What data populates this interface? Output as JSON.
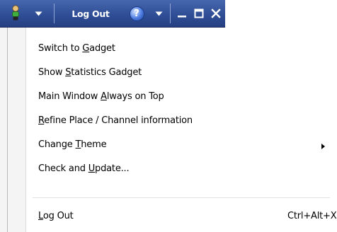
{
  "toolbar": {
    "logout_label": "Log Out",
    "help_glyph": "?",
    "icons": {
      "user": "person-status-icon",
      "menu_dropdown": "chevron-down-icon",
      "help": "help-icon",
      "help_dropdown": "chevron-down-icon",
      "minimize": "minimize-icon",
      "maximize": "maximize-icon",
      "close": "close-icon"
    },
    "colors": {
      "bar": "#2f4e96",
      "text": "#ffffff"
    }
  },
  "menu": {
    "items": [
      {
        "pre": "Switch to ",
        "key": "G",
        "post": "adget",
        "shortcut": "",
        "submenu": false
      },
      {
        "pre": "Show ",
        "key": "S",
        "post": "tatistics Gadget",
        "shortcut": "",
        "submenu": false
      },
      {
        "pre": "Main Window ",
        "key": "A",
        "post": "lways on Top",
        "shortcut": "",
        "submenu": false
      },
      {
        "pre": "",
        "key": "R",
        "post": "efine Place / Channel information",
        "shortcut": "",
        "submenu": false
      },
      {
        "pre": "Change ",
        "key": "T",
        "post": "heme",
        "shortcut": "",
        "submenu": true
      },
      {
        "pre": "Check and ",
        "key": "U",
        "post": "pdate...",
        "shortcut": "",
        "submenu": false
      },
      {
        "pre": "",
        "key": "L",
        "post": "og Out",
        "shortcut": "Ctrl+Alt+X",
        "submenu": false
      }
    ]
  }
}
